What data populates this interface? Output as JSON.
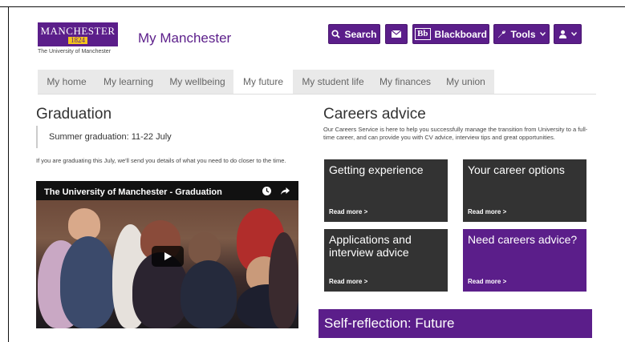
{
  "header": {
    "logo_line1": "MANCHESTER",
    "logo_line2": "1824",
    "logo_subtitle": "The University of Manchester",
    "site_title": "My Manchester",
    "buttons": {
      "search": "Search",
      "blackboard_mark": "Bb",
      "blackboard": "Blackboard",
      "tools": "Tools"
    }
  },
  "nav": {
    "tabs": [
      "My home",
      "My learning",
      "My wellbeing",
      "My future",
      "My student life",
      "My finances",
      "My union"
    ],
    "active": "My future"
  },
  "graduation": {
    "heading": "Graduation",
    "highlight": "Summer graduation: 11-22 July",
    "text": "If you are graduating this July, we'll send you details of what you need to do closer to the time.",
    "video_title": "The University of Manchester - Graduation"
  },
  "careers": {
    "heading": "Careers advice",
    "text": "Our Careers Service is here to help you successfully manage the transition from University to a full-time career, and can provide you with CV advice, interview tips and great opportunities.",
    "cards": [
      {
        "title": "Getting experience",
        "link": "Read more >"
      },
      {
        "title": "Your career options",
        "link": "Read more >"
      },
      {
        "title": "Applications and interview advice",
        "link": "Read more >"
      },
      {
        "title": "Need careers advice?",
        "link": "Read more >"
      }
    ]
  },
  "self_reflection": {
    "heading": "Self-reflection: Future"
  },
  "colors": {
    "brand_purple": "#5b1e8a",
    "card_dark": "#333333",
    "tab_bar": "#e9e9e9"
  },
  "icons": [
    "search-icon",
    "mail-icon",
    "wrench-icon",
    "chevron-down-icon",
    "user-icon",
    "clock-icon",
    "share-icon",
    "play-icon"
  ]
}
